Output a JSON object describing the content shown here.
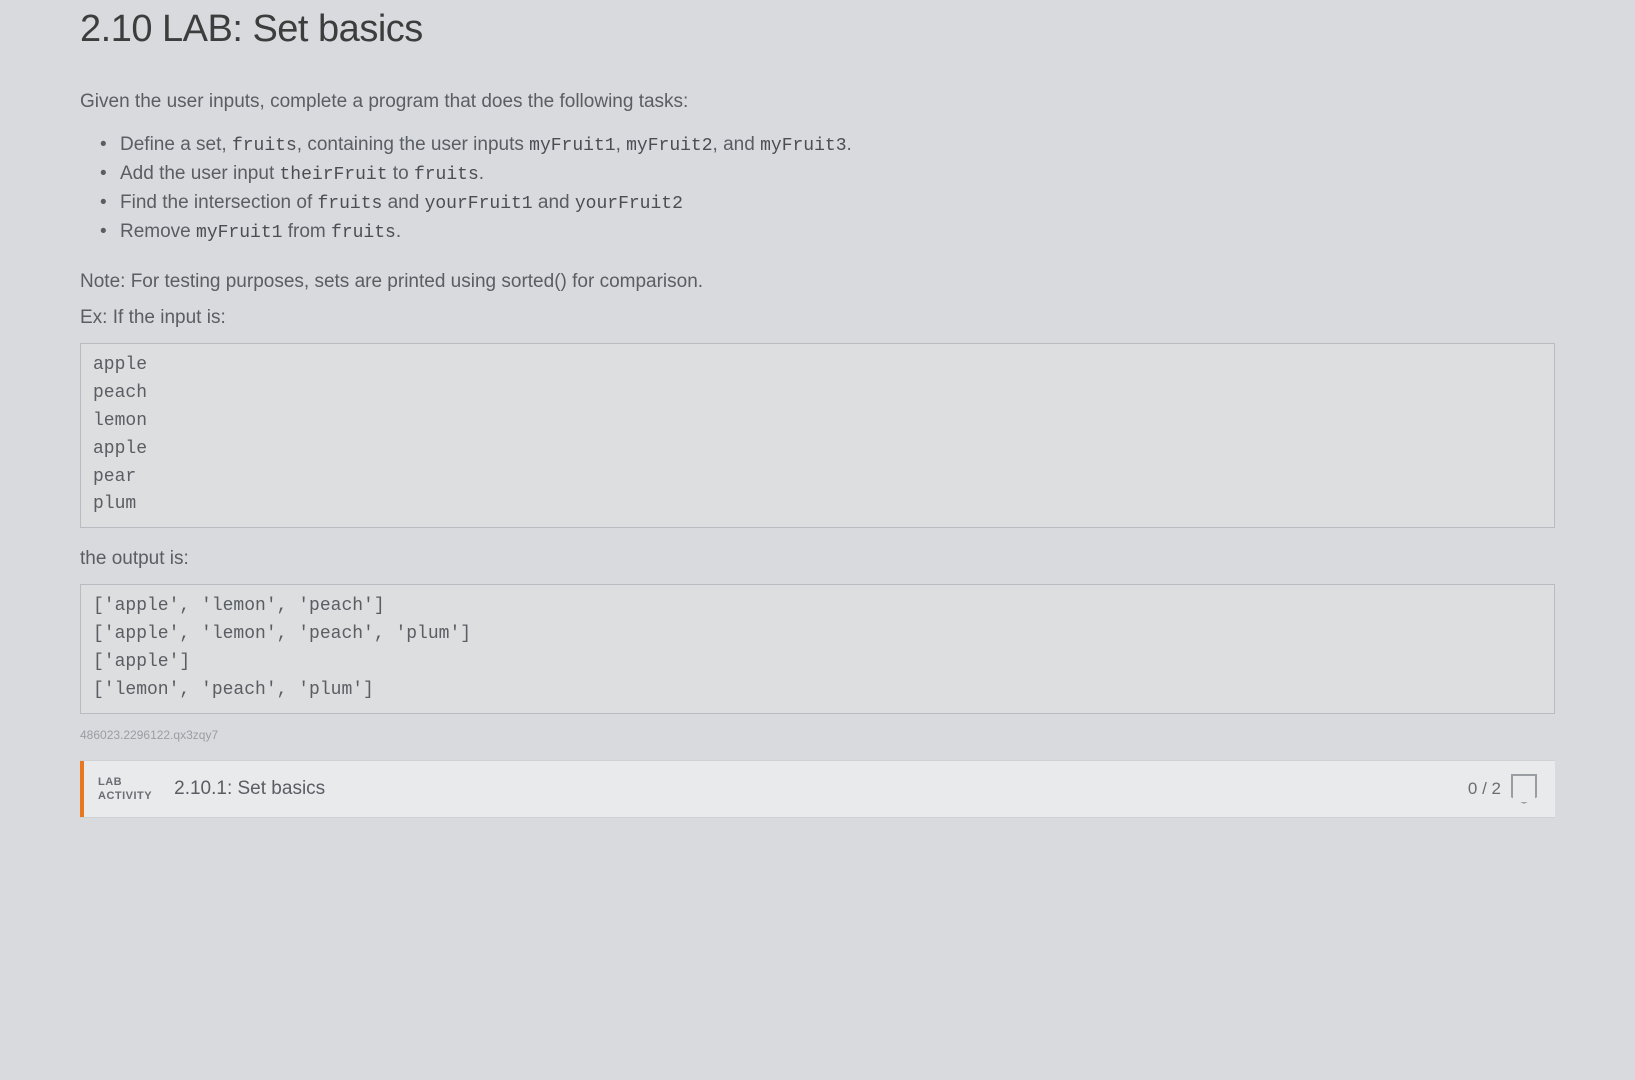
{
  "heading": "2.10 LAB: Set basics",
  "intro": "Given the user inputs, complete a program that does the following tasks:",
  "tasks": [
    {
      "prefix": "Define a set, ",
      "c1": "fruits",
      "mid1": ", containing the user inputs ",
      "c2": "myFruit1",
      "mid2": ", ",
      "c3": "myFruit2",
      "mid3": ", and ",
      "c4": "myFruit3",
      "suffix": "."
    },
    {
      "prefix": "Add the user input ",
      "c1": "theirFruit",
      "mid1": " to ",
      "c2": "fruits",
      "suffix": "."
    },
    {
      "prefix": "Find the intersection of ",
      "c1": "fruits",
      "mid1": " and ",
      "c2": "yourFruit1",
      "mid2": " and ",
      "c3": "yourFruit2",
      "suffix": ""
    },
    {
      "prefix": "Remove ",
      "c1": "myFruit1",
      "mid1": " from ",
      "c2": "fruits",
      "suffix": "."
    }
  ],
  "note": "Note: For testing purposes, sets are printed using sorted() for comparison.",
  "exLabel": "Ex: If the input is:",
  "inputBlock": "apple\npeach\nlemon\napple\npear\nplum",
  "outputLabel": "the output is:",
  "outputBlock": "['apple', 'lemon', 'peach']\n['apple', 'lemon', 'peach', 'plum']\n['apple']\n['lemon', 'peach', 'plum']",
  "watermark": "486023.2296122.qx3zqy7",
  "labBar": {
    "labelLine1": "LAB",
    "labelLine2": "ACTIVITY",
    "title": "2.10.1: Set basics",
    "score": "0 / 2"
  }
}
